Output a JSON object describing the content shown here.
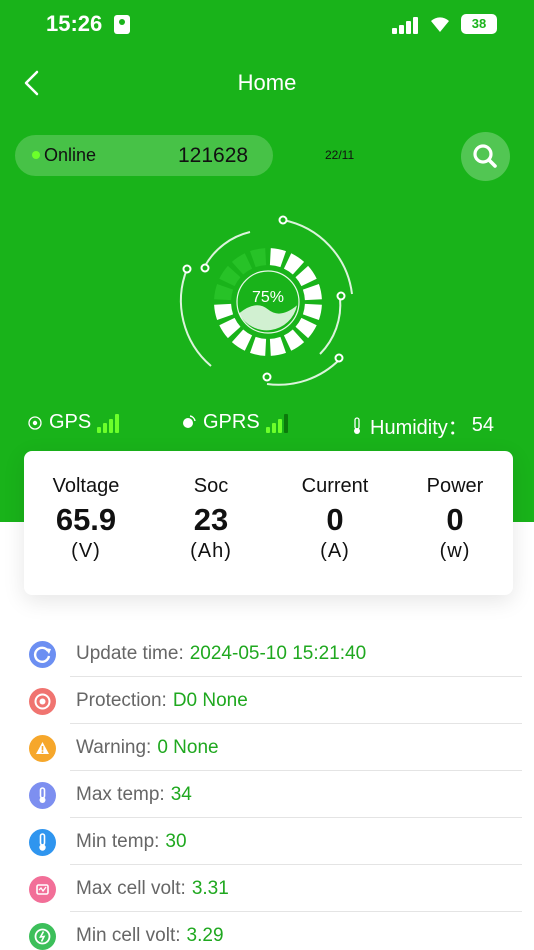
{
  "status_bar": {
    "time": "15:26",
    "battery": "38"
  },
  "header": {
    "title": "Home"
  },
  "device": {
    "status": "Online",
    "id": "121628",
    "date": "22/11"
  },
  "gauge": {
    "percent": "75%",
    "level": 0.75
  },
  "indicators": {
    "gps_label": "GPS",
    "gprs_label": "GPRS",
    "humidity_label": "Humidity：",
    "humidity_value": "54"
  },
  "metrics": [
    {
      "label": "Voltage",
      "value": "65.9",
      "unit": "(V)"
    },
    {
      "label": "Soc",
      "value": "23",
      "unit": "(Ah)"
    },
    {
      "label": "Current",
      "value": "0",
      "unit": "(A)"
    },
    {
      "label": "Power",
      "value": "0",
      "unit": "(w)"
    }
  ],
  "info": [
    {
      "label": "Update time:",
      "value": "2024-05-10 15:21:40",
      "icon": "refresh-icon",
      "color": "#6c8ff2"
    },
    {
      "label": "Protection:",
      "value": "D0 None",
      "icon": "protection-icon",
      "color": "#f07470"
    },
    {
      "label": "Warning:",
      "value": "0 None",
      "icon": "warning-icon",
      "color": "#f6a72b"
    },
    {
      "label": "Max temp:",
      "value": "34",
      "icon": "max-temp-icon",
      "color": "#7d8ff0"
    },
    {
      "label": "Min temp:",
      "value": "30",
      "icon": "min-temp-icon",
      "color": "#2f95ef"
    },
    {
      "label": "Max cell volt:",
      "value": "3.31",
      "icon": "max-cell-icon",
      "color": "#f26f98"
    },
    {
      "label": "Min cell volt:",
      "value": "3.29",
      "icon": "min-cell-icon",
      "color": "#3cbf5a"
    }
  ],
  "colors": {
    "primary_green": "#19b31a",
    "value_green": "#1fa81f"
  }
}
